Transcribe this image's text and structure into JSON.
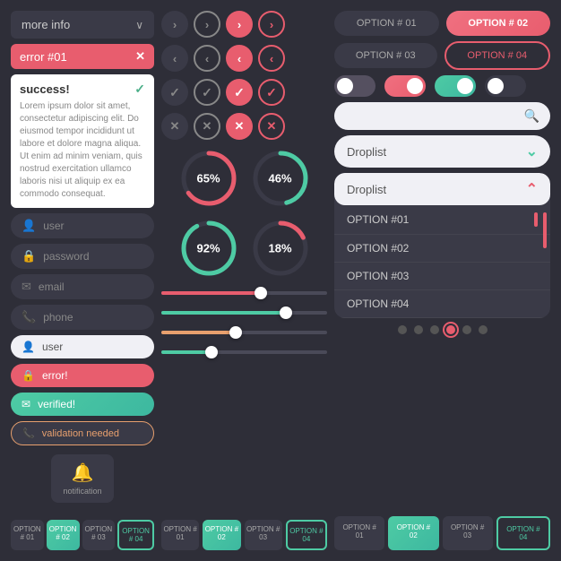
{
  "left": {
    "dropdown_label": "more info",
    "dropdown_chevron": "∨",
    "error_label": "error #01",
    "error_close": "✕",
    "success_title": "success!",
    "success_check": "✓",
    "success_body": "Lorem ipsum dolor sit amet, consectetur adipiscing elit. Do eiusmod tempor incididunt ut labore et dolore magna aliqua. Ut enim ad minim veniam, quis nostrud exercitation ullamco laboris nisi ut aliquip ex ea commodo consequat.",
    "inputs_dark": [
      "user",
      "password",
      "email",
      "phone"
    ],
    "input_light_label": "user",
    "input_error_label": "error!",
    "input_verified_label": "verified!",
    "input_validation_label": "validation needed",
    "notification_label": "notification",
    "bottom_tabs": [
      "OPTION # 01",
      "OPTION # 02",
      "OPTION # 03",
      "OPTION # 04"
    ]
  },
  "middle": {
    "arrow_rows": [
      {
        "buttons": [
          ">",
          ">",
          ">",
          ">"
        ]
      },
      {
        "buttons": [
          "<",
          "<",
          "<",
          "<"
        ]
      }
    ],
    "check_rows": [
      {
        "symbols": [
          "✓",
          "✓",
          "✓",
          "✓"
        ]
      },
      {
        "symbols": [
          "✕",
          "✕",
          "✕",
          "✕"
        ]
      }
    ],
    "progress_circles": [
      {
        "pct": 65,
        "color": "#e85d6e",
        "trail": "#3a3a47"
      },
      {
        "pct": 46,
        "color": "#4ecba4",
        "trail": "#3a3a47"
      },
      {
        "pct": 92,
        "color": "#4ecba4",
        "trail": "#3a3a47"
      },
      {
        "pct": 18,
        "color": "#e85d6e",
        "trail": "#3a3a47"
      }
    ],
    "sliders": [
      {
        "fill_pct": 60,
        "color": "#e85d6e"
      },
      {
        "fill_pct": 75,
        "color": "#4ecba4"
      },
      {
        "fill_pct": 45,
        "color": "#e8a06e"
      },
      {
        "fill_pct": 30,
        "color": "#4ecba4"
      }
    ],
    "bottom_tabs": [
      "OPTION # 01",
      "OPTION # 02",
      "OPTION # 03",
      "OPTION # 04"
    ]
  },
  "right": {
    "top_options": [
      "OPTION # 01",
      "OPTION # 02",
      "OPTION # 03",
      "OPTION # 04"
    ],
    "toggle_states": [
      "off",
      "pink",
      "teal",
      "dark"
    ],
    "search_placeholder": "",
    "droplist_closed_label": "Droplist",
    "droplist_open_label": "Droplist",
    "droplist_options": [
      "OPTION #01",
      "OPTION #02",
      "OPTION #03",
      "OPTION #04"
    ],
    "radio_count": 6,
    "radio_active": 4,
    "bottom_tabs": [
      "OPTION # 01",
      "OPTION # 02",
      "OPTION # 03",
      "OPTION # 04"
    ]
  },
  "icons": {
    "user": "👤",
    "lock": "🔒",
    "email": "✉",
    "phone": "📞",
    "bell": "🔔",
    "search": "🔍",
    "chevron_down": "⌄",
    "chevron_up": "⌃"
  }
}
